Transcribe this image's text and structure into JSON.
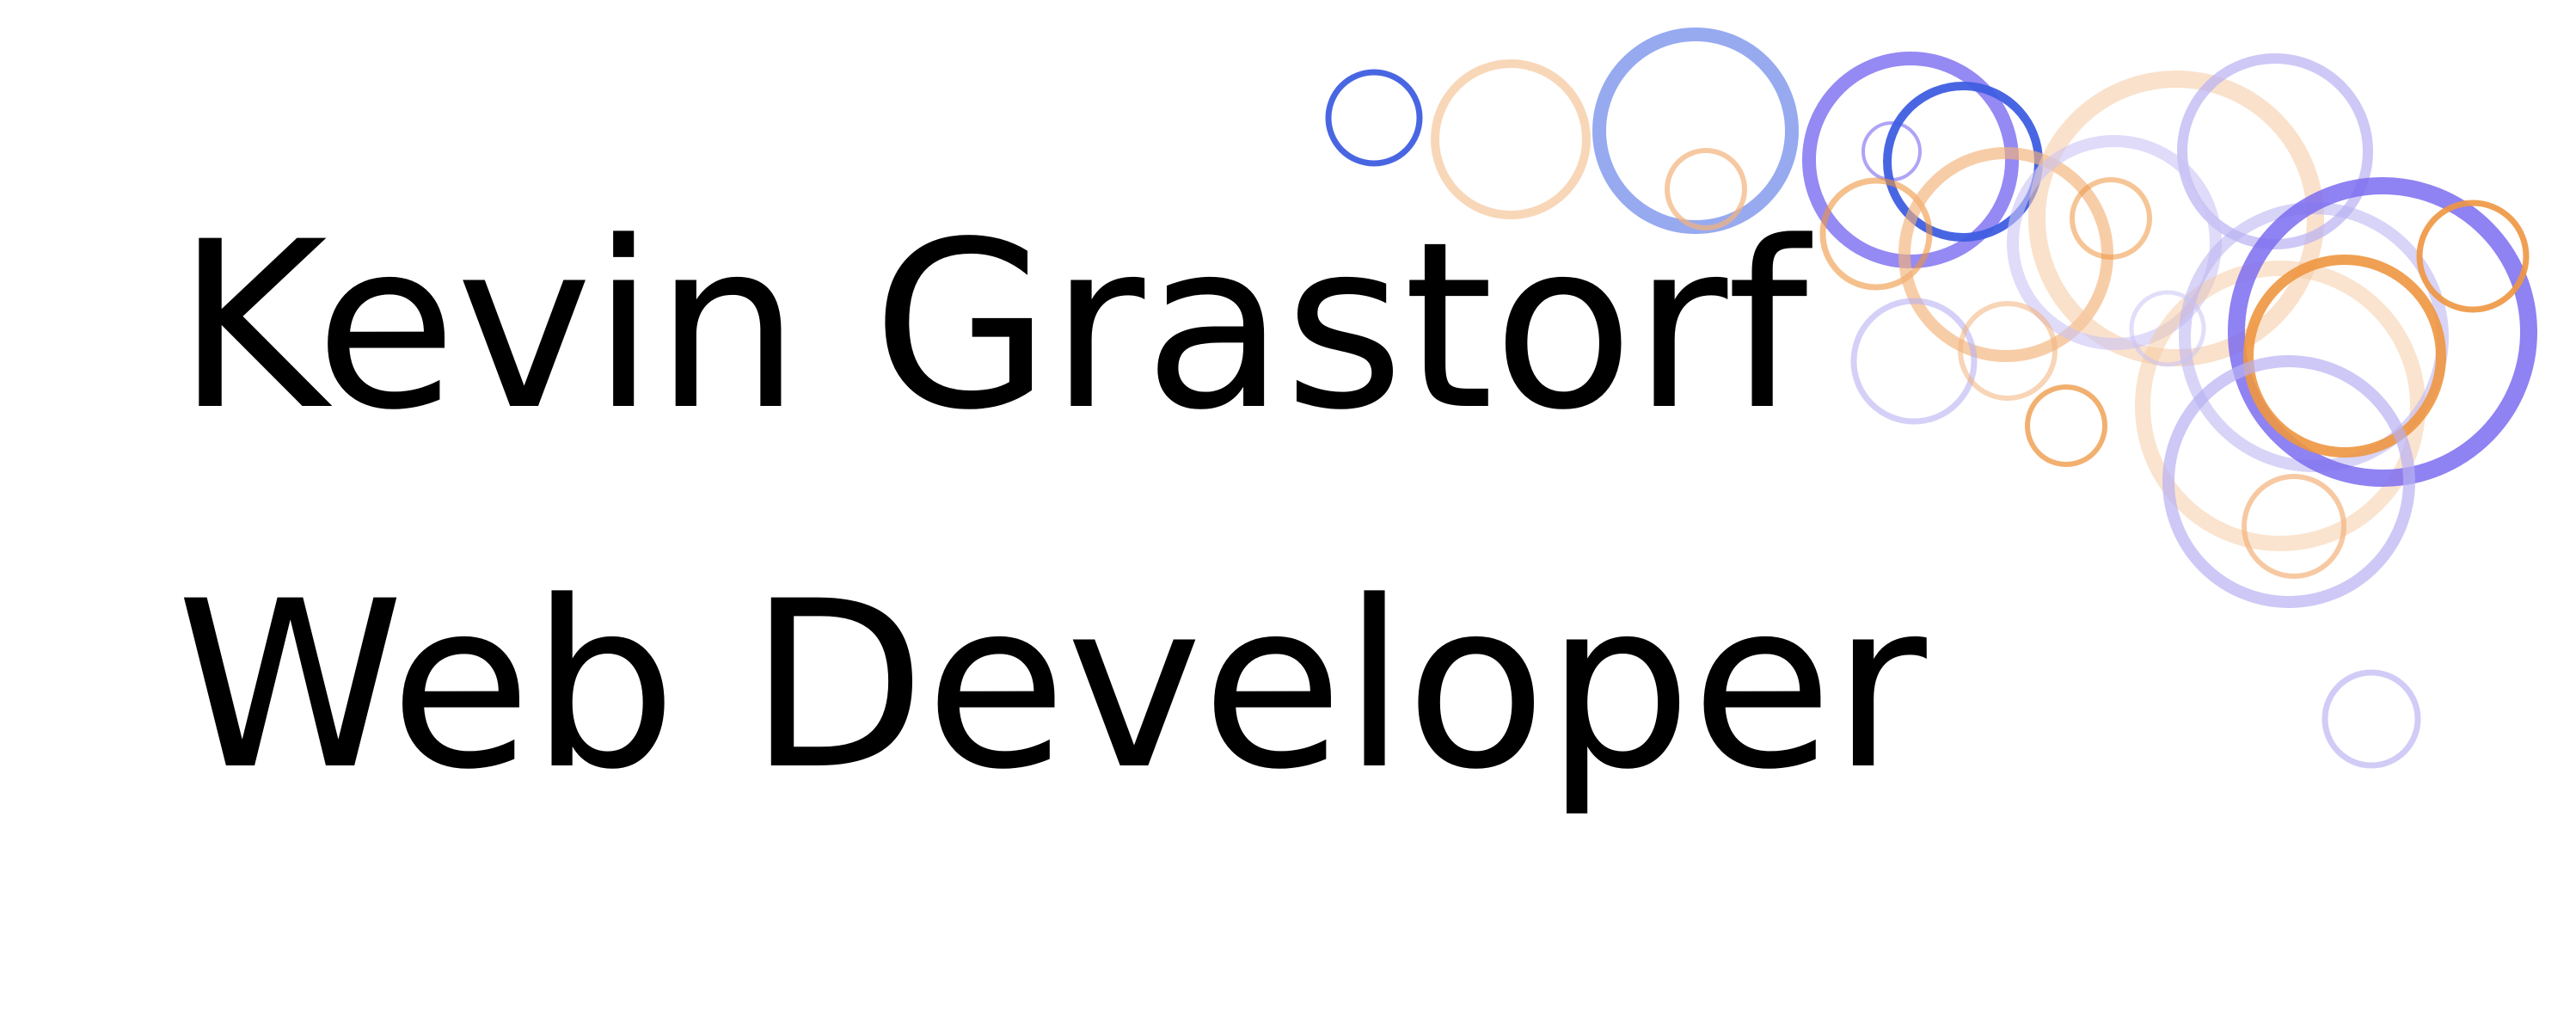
{
  "name": "Kevin Grastorf",
  "title": "Web Developer",
  "colors": {
    "text": "#000000",
    "background": "#ffffff",
    "accent_blue": "#3f5ee0",
    "accent_violet": "#7b6cf0",
    "accent_orange": "#ee9640",
    "accent_peach": "#f6c9a0",
    "accent_lavender": "#b8b0f2"
  }
}
